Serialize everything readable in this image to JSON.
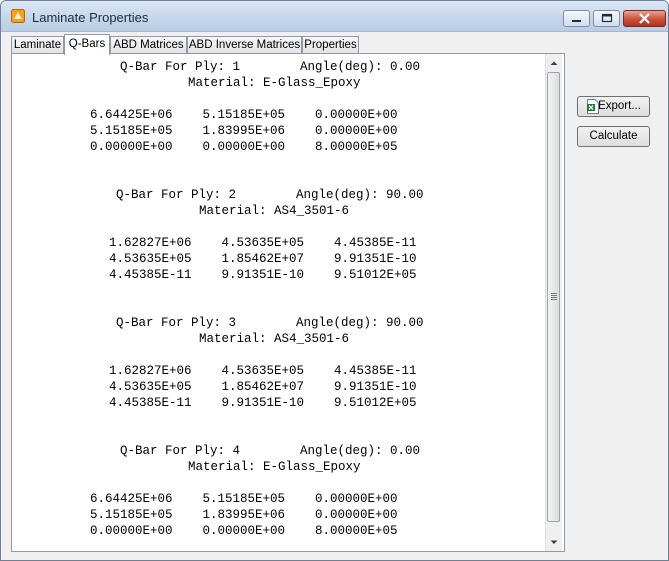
{
  "window": {
    "title": "Laminate Properties",
    "controls": {
      "minimize": "minimize",
      "maximize": "maximize",
      "close": "close"
    }
  },
  "tabs": [
    {
      "label": "Laminate",
      "active": false
    },
    {
      "label": "Q-Bars",
      "active": true
    },
    {
      "label": "ABD Matrices",
      "active": false
    },
    {
      "label": "ABD Inverse Matrices",
      "active": false
    },
    {
      "label": "Properties",
      "active": false
    }
  ],
  "buttons": {
    "export": "Export...",
    "calculate": "Calculate"
  },
  "content": {
    "plies": [
      {
        "header": "Q-Bar For Ply: 1        Angle(deg): 0.00",
        "material": "Material: E-Glass_Epoxy",
        "rows": [
          "6.64425E+06    5.15185E+05    0.00000E+00",
          "5.15185E+05    1.83995E+06    0.00000E+00",
          "0.00000E+00    0.00000E+00    8.00000E+05"
        ]
      },
      {
        "header": "Q-Bar For Ply: 2        Angle(deg): 90.00",
        "material": "Material: AS4_3501-6",
        "rows": [
          "1.62827E+06    4.53635E+05    4.45385E-11",
          "4.53635E+05    1.85462E+07    9.91351E-10",
          "4.45385E-11    9.91351E-10    9.51012E+05"
        ]
      },
      {
        "header": "Q-Bar For Ply: 3        Angle(deg): 90.00",
        "material": "Material: AS4_3501-6",
        "rows": [
          "1.62827E+06    4.53635E+05    4.45385E-11",
          "4.53635E+05    1.85462E+07    9.91351E-10",
          "4.45385E-11    9.91351E-10    9.51012E+05"
        ]
      },
      {
        "header": "Q-Bar For Ply: 4        Angle(deg): 0.00",
        "material": "Material: E-Glass_Epoxy",
        "rows": [
          "6.64425E+06    5.15185E+05    0.00000E+00",
          "5.15185E+05    1.83995E+06    0.00000E+00",
          "0.00000E+00    0.00000E+00    8.00000E+05"
        ]
      }
    ]
  }
}
